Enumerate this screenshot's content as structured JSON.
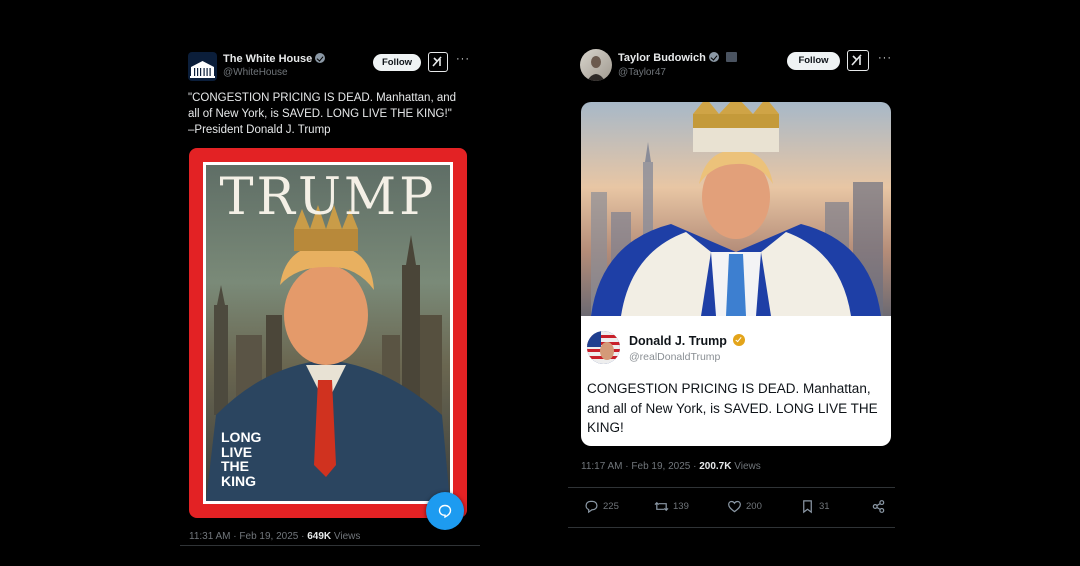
{
  "left_tweet": {
    "display_name": "The White House",
    "handle": "@WhiteHouse",
    "follow_label": "Follow",
    "more_label": "···",
    "text": "\"CONGESTION PRICING IS DEAD. Manhattan, and\nall of New York, is SAVED. LONG LIVE THE KING!\"\n–President Donald J. Trump",
    "cover_title": "TRUMP",
    "cover_caption": [
      "LONG",
      "LIVE",
      "THE",
      "KING"
    ],
    "timestamp": "11:31 AM · Feb 19, 2025 · ",
    "views_count": "649K",
    "views_label": " Views"
  },
  "right_tweet": {
    "display_name": "Taylor Budowich",
    "handle": "@Taylor47",
    "follow_label": "Follow",
    "more_label": "···",
    "quote": {
      "display_name": "Donald J. Trump",
      "handle": "@realDonaldTrump",
      "text": "CONGESTION PRICING IS DEAD. Manhattan, and all of New York, is SAVED. LONG LIVE THE KING!"
    },
    "timestamp": "11:17 AM · Feb 19, 2025 · ",
    "views_count": "200.7K",
    "views_label": " Views",
    "actions": {
      "replies": "225",
      "reposts": "139",
      "likes": "200",
      "bookmarks": "31"
    }
  },
  "colors": {
    "background": "#000000",
    "text_primary": "#e7e9ea",
    "text_secondary": "#71767b",
    "accent": "#1d9bf0",
    "cover_border": "#e32224",
    "gold_badge": "#e3a41a"
  }
}
